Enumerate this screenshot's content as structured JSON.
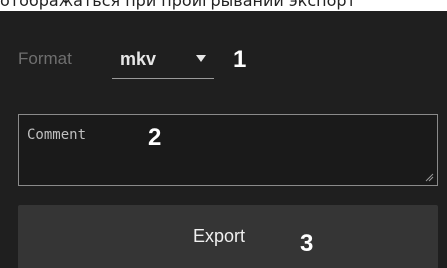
{
  "top_caption": "отображаться при проигрывании экспорт",
  "format": {
    "label": "Format",
    "value": "mkv",
    "caret_icon": "chevron-down-icon"
  },
  "comment": {
    "placeholder": "Comment",
    "value": ""
  },
  "export_button": {
    "label": "Export"
  },
  "callouts": [
    "1",
    "2",
    "3"
  ],
  "colors": {
    "panel_background": "#1f1f1f",
    "button_background": "#353535",
    "label_muted": "#6f6f6f",
    "text_light": "#e6e6e6",
    "border": "#8a8a8a",
    "callout": "#ffffff"
  }
}
